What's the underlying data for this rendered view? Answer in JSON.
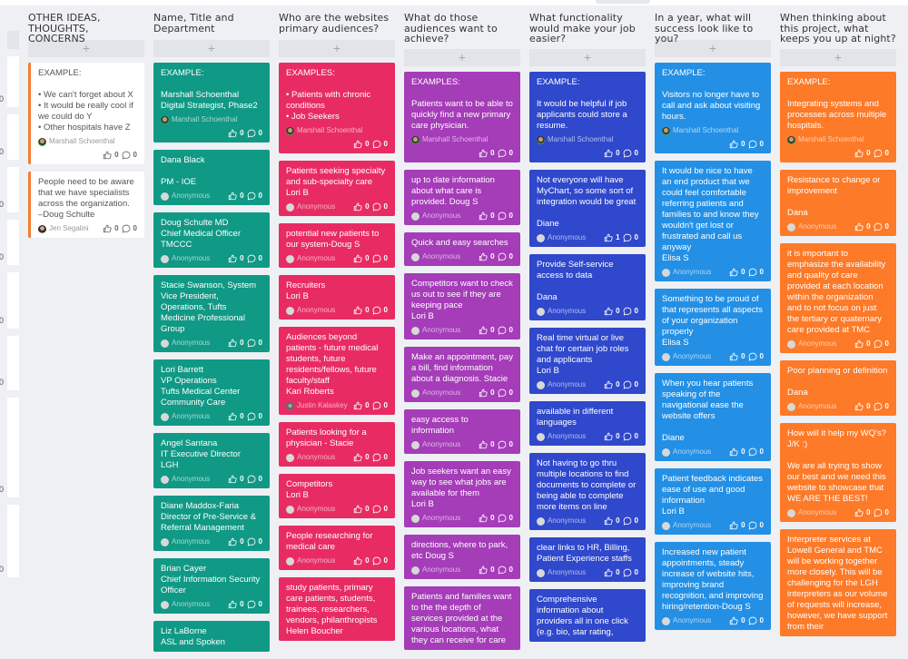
{
  "board": {
    "edge_column": {
      "counts": [
        "0",
        "0",
        "0",
        "0",
        "0",
        "0",
        "0",
        "0"
      ]
    },
    "columns": [
      {
        "id": "other-ideas",
        "title": "OTHER IDEAS, THOUGHTS, CONCERNS",
        "color": "#ffffff",
        "add_label": "+",
        "cards": [
          {
            "text": "EXAMPLE:\n\n• We can't forget about X\n• It would be really cool if we could do Y\n• Other hospitals have Z",
            "author": "Marshall Schoenthal",
            "avatar": "photo",
            "likes": "0",
            "comments": "0"
          },
          {
            "text": "People need to be aware that we have specialists across the organization.\n–Doug Schulte",
            "author": "Jen Segalini",
            "avatar": "photo2",
            "likes": "0",
            "comments": "0"
          }
        ]
      },
      {
        "id": "name-title-dept",
        "title": "Name, Title and Department",
        "color": "#109985",
        "add_label": "+",
        "cards": [
          {
            "text": "EXAMPLE:\n\nMarshall Schoenthal\nDigital Strategist, Phase2",
            "author": "Marshall Schoenthal",
            "avatar": "photo",
            "likes": "0",
            "comments": "0"
          },
          {
            "text": "Dana Black\n\nPM - IOE",
            "author": "Anonymous",
            "likes": "0",
            "comments": "0"
          },
          {
            "text": "Doug Schulte MD\nChief Medical Officer\nTMCCC",
            "author": "Anonymous",
            "likes": "0",
            "comments": "0"
          },
          {
            "text": "Stacie Swanson, System Vice President, Operations, Tufts Medicine Professional Group",
            "author": "Anonymous",
            "likes": "0",
            "comments": "0"
          },
          {
            "text": "Lori Barrett\nVP Operations\nTufts Medical Center Community Care",
            "author": "Anonymous",
            "likes": "0",
            "comments": "0"
          },
          {
            "text": "Angel Santana\nIT Executive Director\nLGH",
            "author": "Anonymous",
            "likes": "0",
            "comments": "0"
          },
          {
            "text": "Diane Maddox-Faria\nDirector of Pre-Service & Referral Management",
            "author": "Anonymous",
            "likes": "0",
            "comments": "0"
          },
          {
            "text": "Brian Cayer\nChief Information Security Officer",
            "author": "Anonymous",
            "likes": "0",
            "comments": "0"
          },
          {
            "text": "Liz LaBorne\nASL and Spoken",
            "author": "",
            "likes": "",
            "comments": ""
          }
        ]
      },
      {
        "id": "primary-audiences",
        "title": "Who are the websites primary audiences?",
        "color": "#e82c63",
        "add_label": "+",
        "cards": [
          {
            "text": "EXAMPLES:\n\n• Patients with chronic conditions\n• Job Seekers",
            "author": "Marshall Schoenthal",
            "avatar": "photo",
            "likes": "0",
            "comments": "0"
          },
          {
            "text": "Patients seeking specialty and sub-specialty care\nLori B",
            "author": "Anonymous",
            "likes": "0",
            "comments": "0"
          },
          {
            "text": "potential new patients to our system-Doug S",
            "author": "Anonymous",
            "likes": "0",
            "comments": "0"
          },
          {
            "text": "Recruiters\nLori B",
            "author": "Anonymous",
            "likes": "0",
            "comments": "0"
          },
          {
            "text": "Audiences beyond patients - future medical students, future residents/fellows, future faculty/staff\nKari Roberts",
            "author": "Justin Kalaskey",
            "avatar": "photo3",
            "likes": "0",
            "comments": "0"
          },
          {
            "text": "Patients looking for a physician - Stacie",
            "author": "Anonymous",
            "likes": "0",
            "comments": "0"
          },
          {
            "text": "Competitors\nLori B",
            "author": "Anonymous",
            "likes": "0",
            "comments": "0"
          },
          {
            "text": "People researching for medical care",
            "author": "Anonymous",
            "likes": "0",
            "comments": "0"
          },
          {
            "text": "study patients, primary care patients, students, trainees, researchers, vendors, philanthropists\nHelen Boucher",
            "author": "",
            "likes": "",
            "comments": ""
          }
        ]
      },
      {
        "id": "audiences-achieve",
        "title": "What do those audiences want to achieve?",
        "color": "#a53cb8",
        "add_label": "+",
        "cards": [
          {
            "text": "EXAMPLES:\n\nPatients want to be able to quickly find a new primary care physician.",
            "author": "Marshall Schoenthal",
            "avatar": "photo",
            "likes": "0",
            "comments": "0"
          },
          {
            "text": "up to date information about what care is provided. Doug S",
            "author": "Anonymous",
            "likes": "0",
            "comments": "0"
          },
          {
            "text": "Quick and easy searches",
            "author": "Anonymous",
            "likes": "0",
            "comments": "0"
          },
          {
            "text": "Competitors want to check us out to see if they are keeping pace\nLori B",
            "author": "Anonymous",
            "likes": "0",
            "comments": "0"
          },
          {
            "text": "Make an appointment, pay a bill, find information about a diagnosis. Stacie",
            "author": "Anonymous",
            "likes": "0",
            "comments": "0"
          },
          {
            "text": "easy access to information",
            "author": "Anonymous",
            "likes": "0",
            "comments": "0"
          },
          {
            "text": "Job seekers want an easy way to see what jobs are available for them\nLori B",
            "author": "Anonymous",
            "likes": "0",
            "comments": "0"
          },
          {
            "text": "directions, where to park, etc Doug S",
            "author": "Anonymous",
            "likes": "0",
            "comments": "0"
          },
          {
            "text": "Patients and families want to the the depth of services provided at the various locations, what they can receive for care",
            "author": "",
            "likes": "",
            "comments": ""
          }
        ]
      },
      {
        "id": "functionality",
        "title": "What functionality would make your job easier?",
        "color": "#2f48cc",
        "add_label": "+",
        "cards": [
          {
            "text": "EXAMPLE:\n\nIt would be helpful if job applicants could store a resume.",
            "author": "Marshall Schoenthal",
            "avatar": "photo",
            "likes": "0",
            "comments": "0"
          },
          {
            "text": "Not everyone will have MyChart, so some sort of integration would be great\n\nDiane",
            "author": "Anonymous",
            "likes": "1",
            "comments": "0"
          },
          {
            "text": "Provide Self-service access to data\n\nDana",
            "author": "Anonymous",
            "likes": "0",
            "comments": "0"
          },
          {
            "text": "Real time virtual or live chat for certain job roles and applicants\nLori B",
            "author": "Anonymous",
            "likes": "0",
            "comments": "0"
          },
          {
            "text": "available in different languages",
            "author": "Anonymous",
            "likes": "0",
            "comments": "0"
          },
          {
            "text": "Not having to go thru multiple locations to find documents to complete or being able to complete more items on line",
            "author": "Anonymous",
            "likes": "0",
            "comments": "0"
          },
          {
            "text": "clear links to HR, Billing, Patient Experience staffs",
            "author": "Anonymous",
            "likes": "0",
            "comments": "0"
          },
          {
            "text": "Comprehensive information about providers all in one click (e.g. bio, star rating,",
            "author": "",
            "likes": "",
            "comments": ""
          }
        ]
      },
      {
        "id": "success",
        "title": "In a year, what will success look like to you?",
        "color": "#2390e6",
        "add_label": "+",
        "cards": [
          {
            "text": "EXAMPLE:\n\nVisitors no longer have to call and ask about visiting hours.",
            "author": "Marshall Schoenthal",
            "avatar": "photo",
            "likes": "0",
            "comments": "0"
          },
          {
            "text": "It would be nice to have an end product that we could feel comfortable referring patients and families to and know they wouldn't get lost or frustrated and call us anyway\nElisa S",
            "author": "Anonymous",
            "likes": "0",
            "comments": "0"
          },
          {
            "text": "Something to be proud of that represents all aspects of your organization properly\nElisa S",
            "author": "Anonymous",
            "likes": "0",
            "comments": "0"
          },
          {
            "text": "When you hear patients speaking of the navigational ease the website offers\n\nDiane",
            "author": "Anonymous",
            "likes": "0",
            "comments": "0"
          },
          {
            "text": "Patient feedback indicates ease of use and good information\nLori B",
            "author": "Anonymous",
            "likes": "0",
            "comments": "0"
          },
          {
            "text": "Increased new patient appointments, steady increase of website hits, improving brand recognition, and improving hiring/retention-Doug S",
            "author": "Anonymous",
            "likes": "0",
            "comments": "0"
          }
        ]
      },
      {
        "id": "keeps-up-at-night",
        "title": "When thinking about this project, what keeps you up at night?",
        "color": "#fd7a28",
        "add_label": "+",
        "cards": [
          {
            "text": "EXAMPLE:\n\nIntegrating systems and processes across multiple hospitals.",
            "author": "Marshall Schoenthal",
            "avatar": "photo",
            "likes": "0",
            "comments": "0"
          },
          {
            "text": "Resistance to change or improvement\n\nDana",
            "author": "Anonymous",
            "likes": "0",
            "comments": "0"
          },
          {
            "text": "it is important to emphasize the availability and quality of care provided at each location within the organization and to not focus on just the tertiary or quaternary care provided at TMC",
            "author": "Anonymous",
            "likes": "0",
            "comments": "0"
          },
          {
            "text": "Poor planning or definition\n\nDana",
            "author": "Anonymous",
            "likes": "0",
            "comments": "0"
          },
          {
            "text": "How will it help my WQ's? J/K :)\n\nWe are all trying to show our best and we need this website to showcase that WE ARE THE BEST!",
            "author": "Anonymous",
            "likes": "0",
            "comments": "0"
          },
          {
            "text": "Interpreter services at Lowell General and TMC will be working together more closely. This will be challenging for the LGH interpreters as our volume of requests will increase, however, we have support from their",
            "author": "",
            "likes": "",
            "comments": ""
          }
        ]
      }
    ]
  }
}
